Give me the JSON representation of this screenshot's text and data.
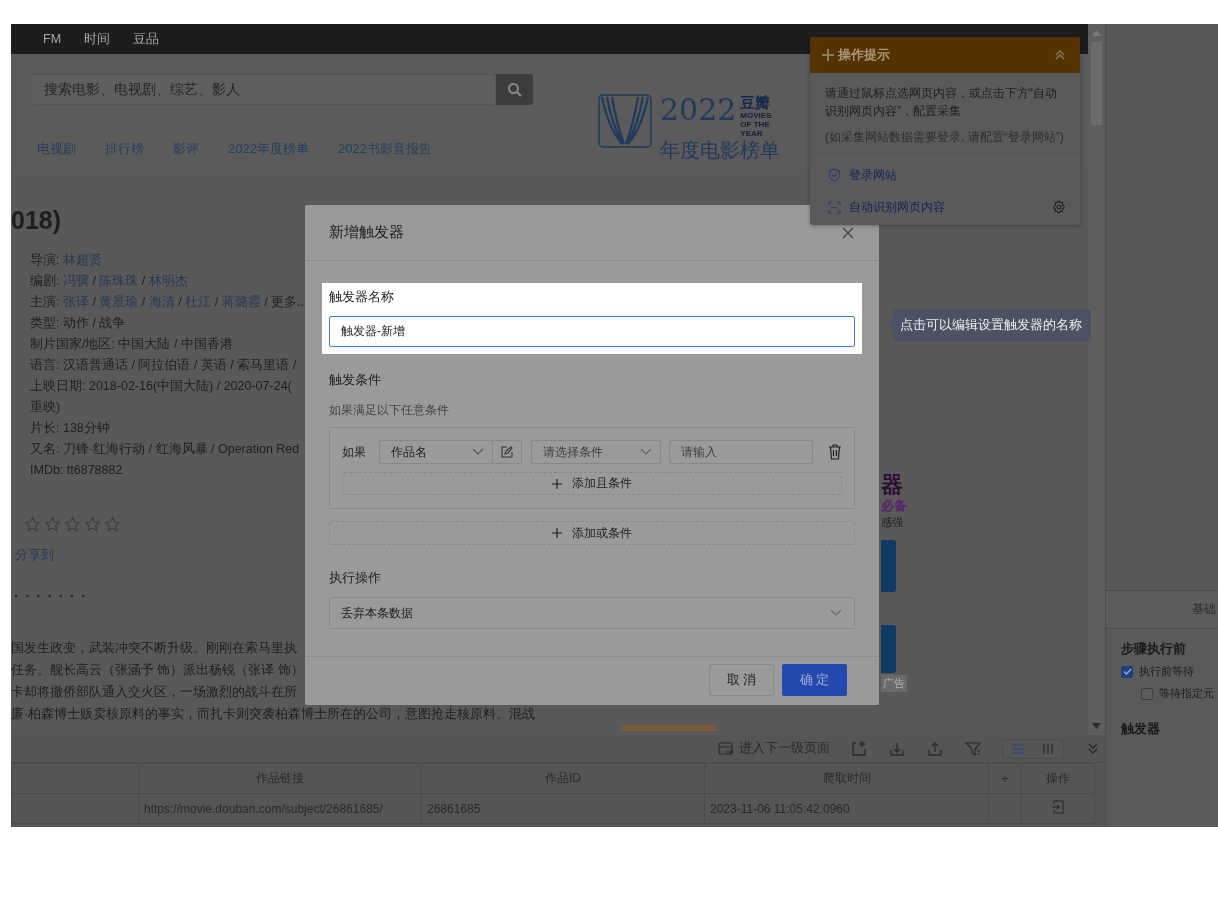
{
  "topbar": {
    "items": [
      "FM",
      "时间",
      "豆品"
    ]
  },
  "search": {
    "placeholder": "搜索电影、电视剧、综艺、影人"
  },
  "logo": {
    "year": "2022",
    "brand": "豆瓣",
    "tagline": "MOVIES OF THE YEAR",
    "subtitle": "年度电影榜单"
  },
  "nav": [
    "电视剧",
    "排行榜",
    "影评",
    "2022年度榜单",
    "2022书影音报告"
  ],
  "movie": {
    "title": "018)",
    "info": [
      {
        "kind": "links",
        "label": "导演:",
        "values": [
          "林超贤"
        ]
      },
      {
        "kind": "links",
        "label": "编剧:",
        "values": [
          "冯骥",
          "陈珠珠",
          "林明杰"
        ],
        "separator": "/"
      },
      {
        "kind": "links",
        "label": "主演:",
        "values": [
          "张译",
          "黄景瑜",
          "海清",
          "杜江",
          "蒋璐霞"
        ],
        "separator": "/",
        "more": "更多.."
      },
      {
        "kind": "text",
        "label": "类型:",
        "value": "动作 / 战争"
      },
      {
        "kind": "text",
        "label": "制片国家/地区:",
        "value": "中国大陆 / 中国香港"
      },
      {
        "kind": "text",
        "label": "语言:",
        "value": "汉语普通话 / 阿拉伯语 / 英语 / 索马里语 /"
      },
      {
        "kind": "text",
        "label": "上映日期:",
        "value": "2018-02-16(中国大陆) / 2020-07-24("
      },
      {
        "kind": "text",
        "value": "重映)"
      },
      {
        "kind": "text",
        "label": "片长:",
        "value": "138分钟"
      },
      {
        "kind": "text",
        "label": "又名:",
        "value": "刀锋·红海行动 / 红海风暴 / Operation Red"
      },
      {
        "kind": "text",
        "label": "IMDb:",
        "value": "tt6878882"
      }
    ],
    "rating": {
      "stars": 0
    },
    "share": "分享到",
    "dots": "· · · · · · ·",
    "synopsis": [
      "国发生政变，武装冲突不断升级。刚刚在索马里执",
      "任务。舰长高云（张涵予 饰）派出杨锐（张译 饰）",
      "卡却将撤侨部队通入交火区，一场激烈的战斗在所",
      "廉·柏森博士贩卖核原料的事实，而扎卡则突袭柏森博士所在的公司，意图抢走核原料。混战"
    ]
  },
  "ad": {
    "title": "器",
    "highlight": "必备",
    "text": "感强",
    "label": "广告"
  },
  "tips": {
    "title": "操作提示",
    "body": "请通过鼠标点选网页内容，或点击下方“自动识别网页内容”，配置采集",
    "note": "(如采集网站数据需要登录, 请配置“登录网站”)",
    "links": [
      {
        "kind": "login",
        "label": "登录网站"
      },
      {
        "kind": "detect",
        "label": "自动识别网页内容"
      }
    ]
  },
  "modal": {
    "title": "新增触发器",
    "name_label": "触发器名称",
    "name_value": "触发器-新增",
    "conditions_title": "触发条件",
    "conditions_hint": "如果满足以下任意条件",
    "condition": {
      "prefix": "如果",
      "field": "作品名",
      "operator_placeholder": "请选择条件",
      "value_placeholder": "请输入"
    },
    "add_and": "添加且条件",
    "add_or": "添加或条件",
    "action_title": "执行操作",
    "action_value": "丢弃本条数据",
    "cancel": "取 消",
    "confirm": "确 定"
  },
  "tooltip": "点击可以编辑设置触发器的名称",
  "toolbar": {
    "next_page": "进入下一级页面",
    "views": [
      {
        "kind": "list",
        "selected": true
      },
      {
        "kind": "columns",
        "selected": false
      }
    ]
  },
  "table": {
    "columns": [
      "作品链接",
      "作品ID",
      "爬取时间",
      "+",
      "操作"
    ],
    "rows": [
      {
        "cells": [
          "https://movie.douban.com/subject/26861685/",
          "26861685",
          "2023-11-06 11:05:42.0960"
        ]
      }
    ]
  },
  "side": {
    "tab": "基础",
    "section": "步骤执行前",
    "options": [
      {
        "label": "执行前等待",
        "checked": true,
        "children": [
          {
            "label": "等待指定元",
            "checked": false
          }
        ]
      }
    ],
    "triggers_title": "触发器"
  }
}
